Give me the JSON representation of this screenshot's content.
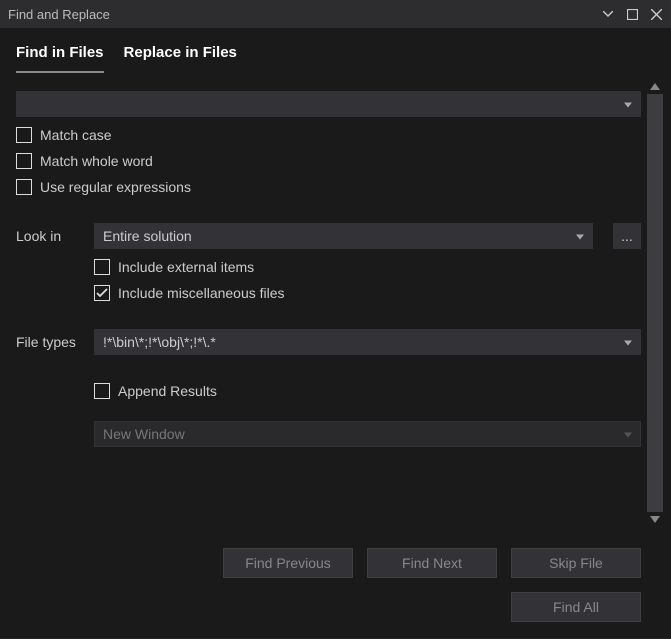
{
  "window": {
    "title": "Find and Replace"
  },
  "tabs": {
    "find": "Find in Files",
    "replace": "Replace in Files"
  },
  "search": {
    "term": ""
  },
  "options": {
    "match_case": "Match case",
    "match_whole_word": "Match whole word",
    "use_regex": "Use regular expressions",
    "include_external": "Include external items",
    "include_misc": "Include miscellaneous files",
    "append_results": "Append Results"
  },
  "look_in": {
    "label": "Look in",
    "value": "Entire solution",
    "browse": "..."
  },
  "file_types": {
    "label": "File types",
    "value": "!*\\bin\\*;!*\\obj\\*;!*\\.*"
  },
  "results": {
    "target": "New Window"
  },
  "buttons": {
    "find_previous": "Find Previous",
    "find_next": "Find Next",
    "skip_file": "Skip File",
    "find_all": "Find All"
  }
}
